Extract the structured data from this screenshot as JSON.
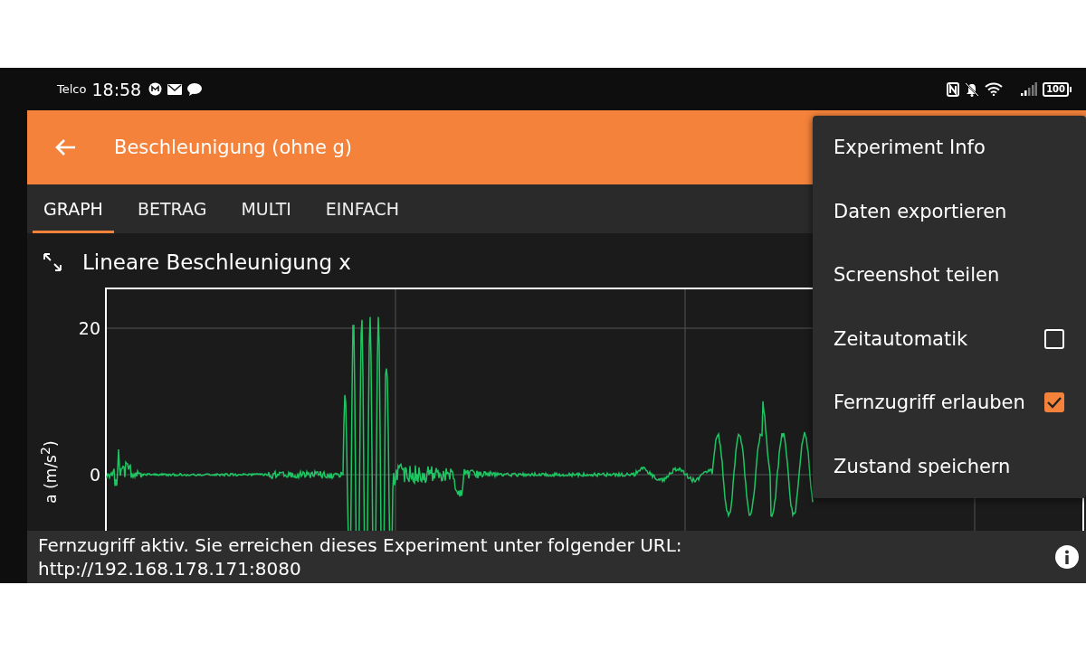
{
  "status_bar": {
    "carrier": "Telco",
    "time": "18:58",
    "battery": "100"
  },
  "app_bar": {
    "title": "Beschleunigung (ohne g)"
  },
  "tabs": [
    {
      "label": "GRAPH",
      "selected": true
    },
    {
      "label": "BETRAG",
      "selected": false
    },
    {
      "label": "MULTI",
      "selected": false
    },
    {
      "label": "EINFACH",
      "selected": false
    }
  ],
  "graph": {
    "title": "Lineare Beschleunigung x",
    "ylabel": "a (m/s$^{2}$)",
    "yticks": [
      "20",
      "0"
    ]
  },
  "menu": [
    {
      "kind": "action",
      "label": "Experiment Info"
    },
    {
      "kind": "action",
      "label": "Daten exportieren"
    },
    {
      "kind": "action",
      "label": "Screenshot teilen"
    },
    {
      "kind": "checkbox",
      "label": "Zeitautomatik",
      "checked": false
    },
    {
      "kind": "checkbox",
      "label": "Fernzugriff erlauben",
      "checked": true
    },
    {
      "kind": "action",
      "label": "Zustand speichern"
    }
  ],
  "banner": {
    "lines": [
      "Fernzugriff aktiv. Sie erreichen dieses Experiment unter folgender URL:",
      "http://192.168.178.171:8080"
    ]
  }
}
